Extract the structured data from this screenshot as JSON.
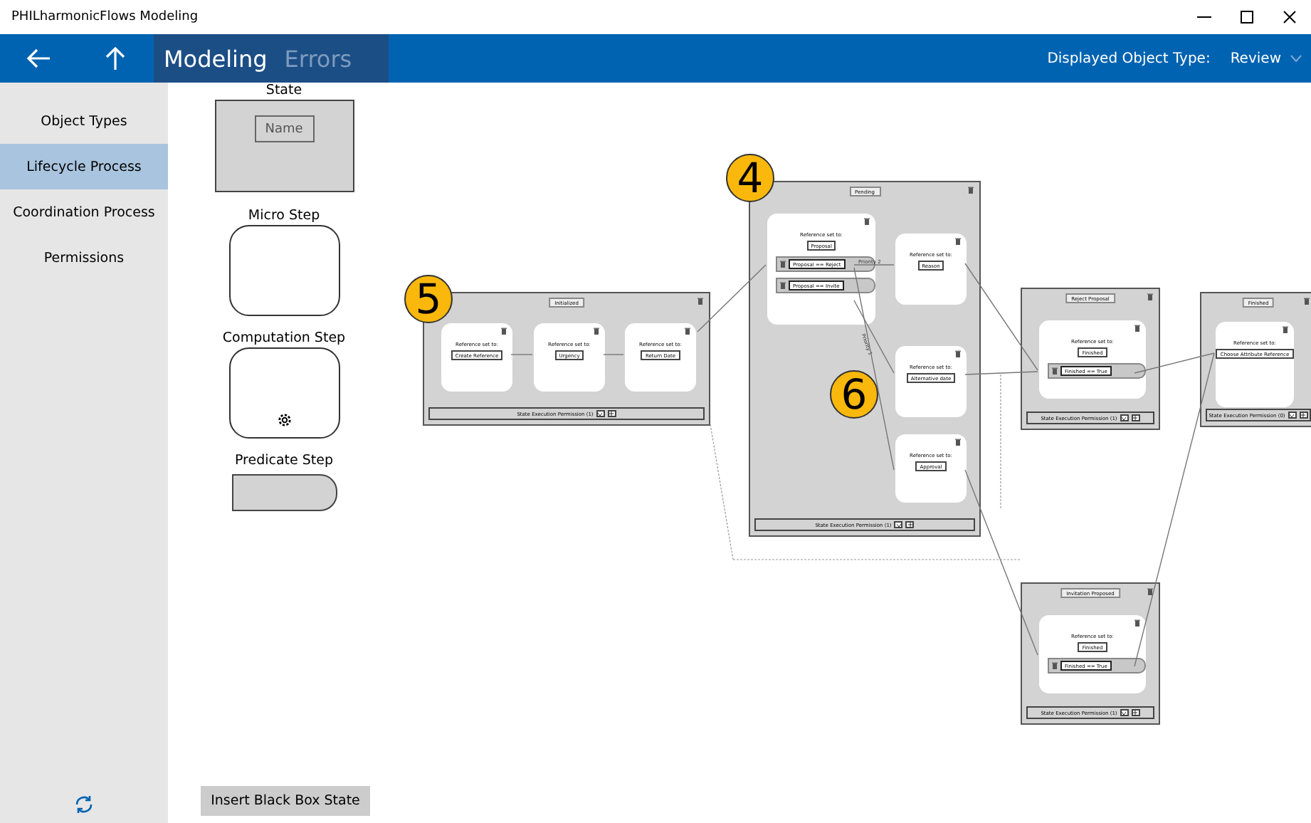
{
  "window": {
    "title": "PHILharmonicFlows Modeling"
  },
  "header": {
    "tabs": [
      {
        "label": "Modeling",
        "selected": true
      },
      {
        "label": "Errors",
        "selected": false
      }
    ],
    "object_type_label": "Displayed Object Type:",
    "object_type_value": "Review"
  },
  "sidebar": {
    "items": [
      {
        "label": "Object Types",
        "selected": false
      },
      {
        "label": "Lifecycle Process",
        "selected": true
      },
      {
        "label": "Coordination Process",
        "selected": false
      },
      {
        "label": "Permissions",
        "selected": false
      }
    ]
  },
  "palette": [
    {
      "label": "State",
      "kind": "state",
      "field": "Name"
    },
    {
      "label": "Micro Step",
      "kind": "micro"
    },
    {
      "label": "Computation Step",
      "kind": "computation"
    },
    {
      "label": "Predicate Step",
      "kind": "predicate"
    }
  ],
  "insert_button": "Insert Black Box State",
  "states": [
    {
      "title": "Initialized",
      "permission": "State Execution Permission (1)",
      "steps": [
        {
          "label": "Reference set to:",
          "value": "Create Reference"
        },
        {
          "label": "Reference set to:",
          "value": "Urgency"
        },
        {
          "label": "Reference set to:",
          "value": "Return Date"
        }
      ]
    },
    {
      "title": "Pending",
      "permission": "State Execution Permission (1)",
      "steps": [
        {
          "label": "Reference set to:",
          "value": "Proposal",
          "predicates": [
            "Proposal == Reject",
            "Proposal == Invite"
          ]
        },
        {
          "label": "Reference set to:",
          "value": "Reason"
        },
        {
          "label": "Reference set to:",
          "value": "Alternative date"
        },
        {
          "label": "Reference set to:",
          "value": "Approval"
        }
      ]
    },
    {
      "title": "Reject Proposal",
      "permission": "State Execution Permission (1)",
      "steps": [
        {
          "label": "Reference set to:",
          "value": "Finished",
          "predicates": [
            "Finished == True"
          ]
        }
      ]
    },
    {
      "title": "Finished",
      "permission": "State Execution Permission (0)",
      "steps": [
        {
          "label": "Reference set to:",
          "value": "Choose Attribute Reference"
        }
      ]
    },
    {
      "title": "Invitation Proposed",
      "permission": "State Execution Permission (1)",
      "steps": [
        {
          "label": "Reference set to:",
          "value": "Finished",
          "predicates": [
            "Finished == True"
          ]
        }
      ]
    }
  ],
  "edge_labels": [
    "Priority 2",
    "Priority 1"
  ],
  "callouts": [
    "4",
    "5",
    "6"
  ]
}
